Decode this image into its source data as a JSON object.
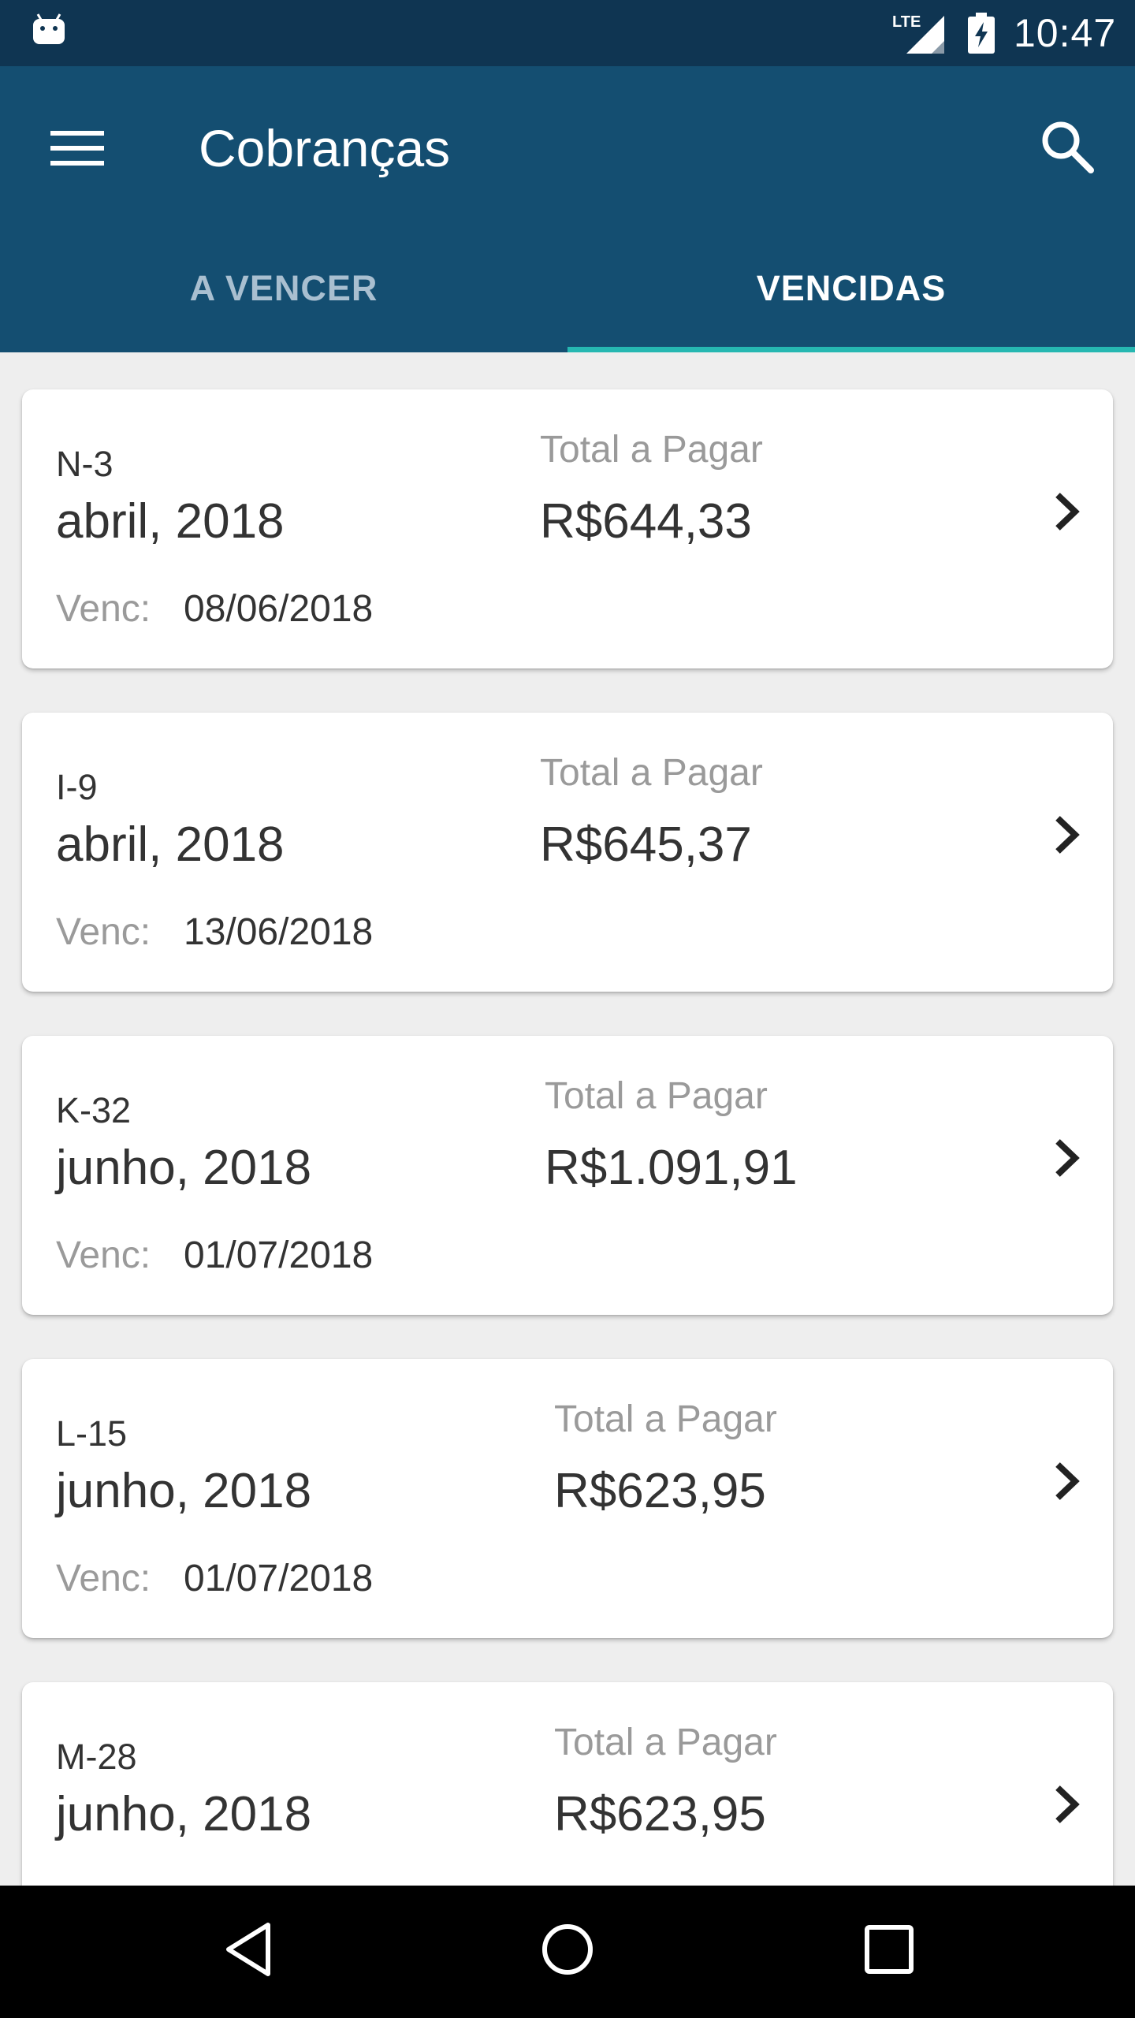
{
  "status_bar": {
    "time": "10:47",
    "network_label": "LTE",
    "icons": [
      "android-icon",
      "lte-signal-icon",
      "battery-charging-icon"
    ]
  },
  "app_bar": {
    "title": "Cobranças",
    "menu_icon": "menu-icon",
    "search_icon": "search-icon",
    "color": "#144e71"
  },
  "tabs": [
    {
      "label": "A VENCER",
      "selected": false
    },
    {
      "label": "VENCIDAS",
      "selected": true
    }
  ],
  "accent_color": "#26b7b1",
  "invoices": [
    {
      "code": "N-3",
      "period": "abril, 2018",
      "venc_label": "Venc:",
      "due_date": "08/06/2018",
      "total_label": "Total a Pagar",
      "total": "R$644,33"
    },
    {
      "code": "I-9",
      "period": "abril, 2018",
      "venc_label": "Venc:",
      "due_date": "13/06/2018",
      "total_label": "Total a Pagar",
      "total": "R$645,37"
    },
    {
      "code": "K-32",
      "period": "junho, 2018",
      "venc_label": "Venc:",
      "due_date": "01/07/2018",
      "total_label": "Total a Pagar",
      "total": "R$1.091,91"
    },
    {
      "code": "L-15",
      "period": "junho, 2018",
      "venc_label": "Venc:",
      "due_date": "01/07/2018",
      "total_label": "Total a Pagar",
      "total": "R$623,95"
    },
    {
      "code": "M-28",
      "period": "junho, 2018",
      "venc_label": "Venc:",
      "due_date": "",
      "total_label": "Total a Pagar",
      "total": "R$623,95"
    }
  ],
  "nav_bar": {
    "icons": [
      "back-icon",
      "home-icon",
      "recents-icon"
    ]
  }
}
